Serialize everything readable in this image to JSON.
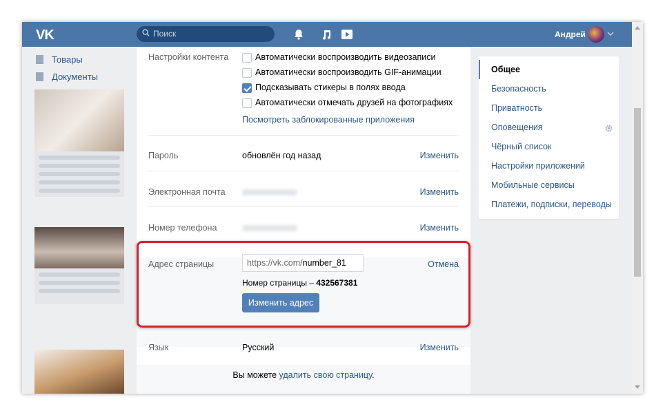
{
  "header": {
    "logo": "VK",
    "search_placeholder": "Поиск",
    "username": "Андрей"
  },
  "leftnav": {
    "items": [
      {
        "label": "Товары"
      },
      {
        "label": "Документы"
      }
    ]
  },
  "settings": {
    "content_label": "Настройки контента",
    "checkboxes": [
      {
        "label": "Автоматически воспроизводить видеозаписи",
        "checked": false
      },
      {
        "label": "Автоматически воспроизводить GIF-анимации",
        "checked": false
      },
      {
        "label": "Подсказывать стикеры в полях ввода",
        "checked": true
      },
      {
        "label": "Автоматически отмечать друзей на фотографиях",
        "checked": false
      }
    ],
    "blocked_apps_link": "Посмотреть заблокированные приложения",
    "password": {
      "label": "Пароль",
      "value": "обновлён год назад",
      "action": "Изменить"
    },
    "email": {
      "label": "Электронная почта",
      "action": "Изменить"
    },
    "phone": {
      "label": "Номер телефона",
      "action": "Изменить"
    },
    "address": {
      "label": "Адрес страницы",
      "url_prefix": "https://vk.com/",
      "url_value": "number_81",
      "page_number_label": "Номер страницы –",
      "page_number": "432567381",
      "submit": "Изменить адрес",
      "cancel": "Отмена"
    },
    "language": {
      "label": "Язык",
      "value": "Русский",
      "action": "Изменить"
    },
    "footer_text": "Вы можете",
    "footer_link": "удалить свою страницу",
    "footer_end": "."
  },
  "rightmenu": {
    "items": [
      {
        "label": "Общее",
        "active": true
      },
      {
        "label": "Безопасность"
      },
      {
        "label": "Приватность"
      },
      {
        "label": "Оповещения"
      },
      {
        "label": "Чёрный список"
      },
      {
        "label": "Настройки приложений"
      },
      {
        "label": "Мобильные сервисы"
      },
      {
        "label": "Платежи, подписки, переводы"
      }
    ]
  },
  "colors": {
    "brand": "#4a76a8",
    "link": "#2a5885",
    "button": "#5181b8",
    "highlight": "#d8212b"
  }
}
